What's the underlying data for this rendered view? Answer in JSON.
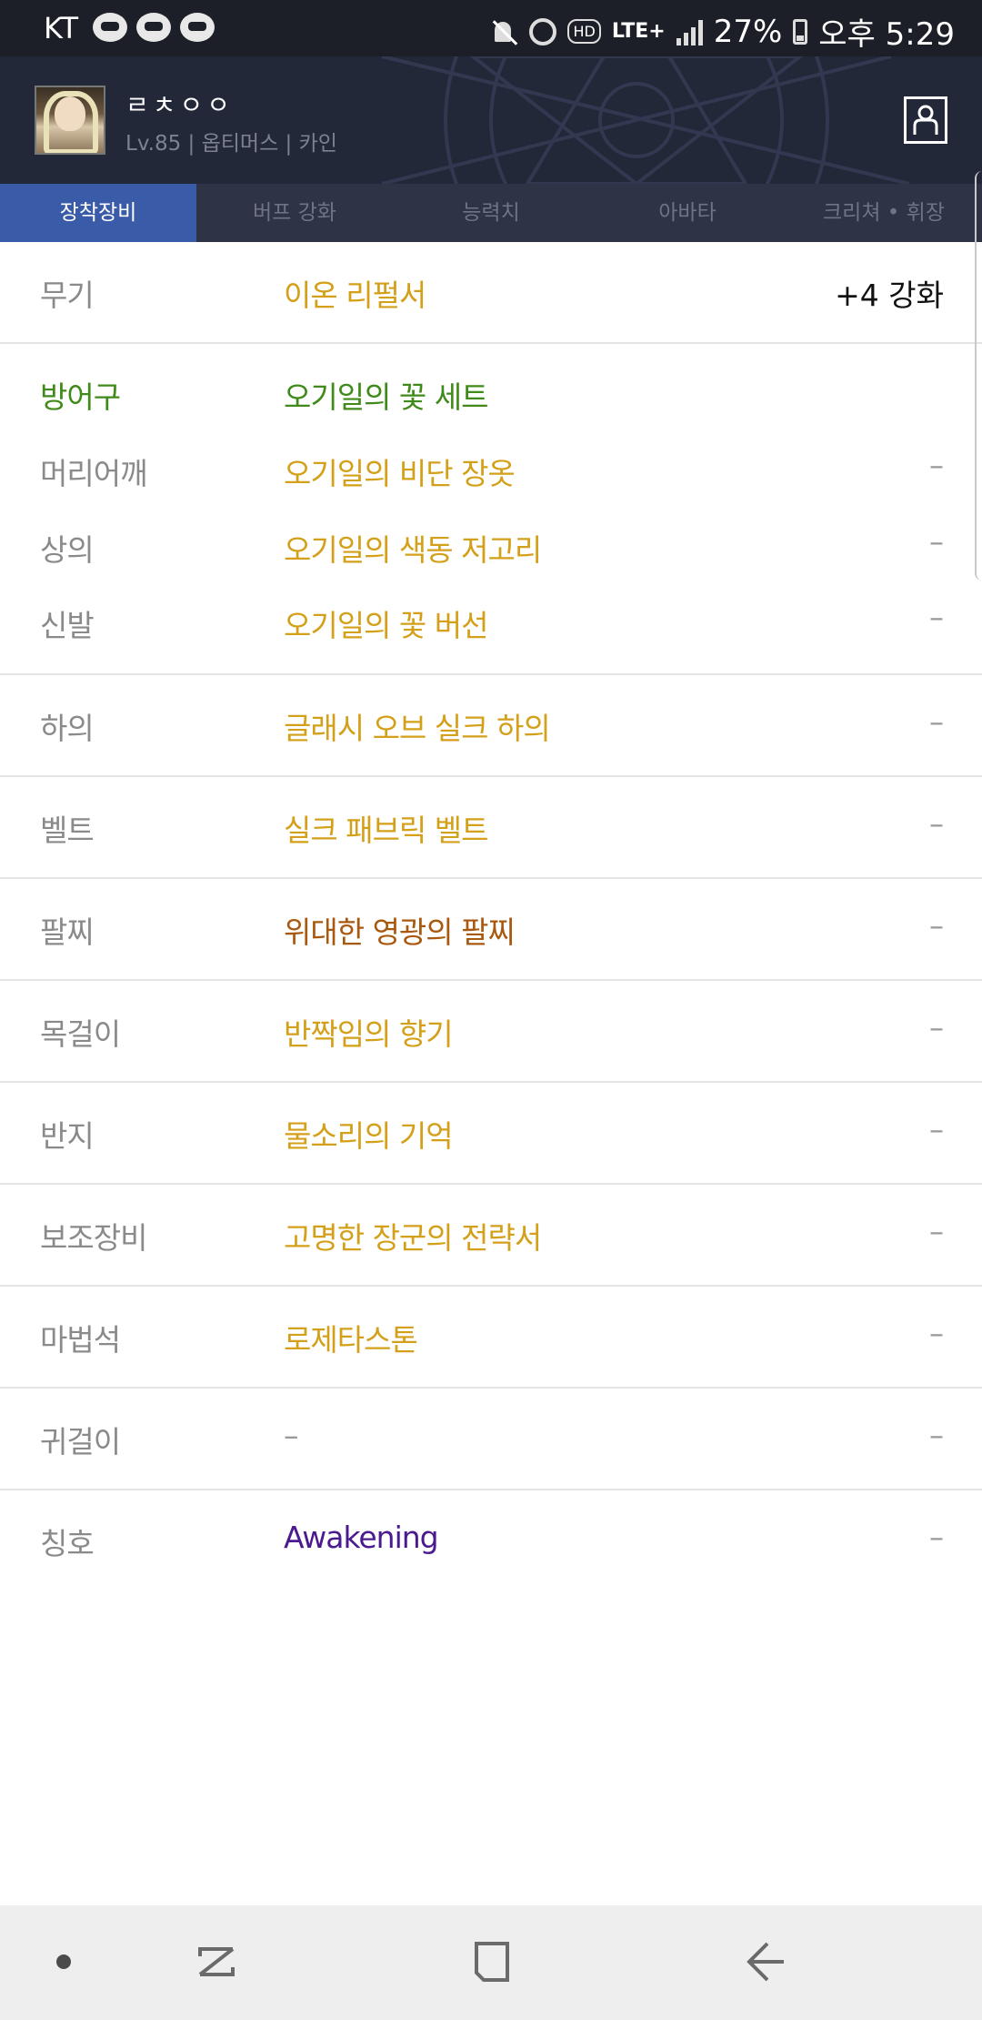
{
  "status_bar": {
    "carrier": "KT",
    "notification_icons": [
      "game-controller-icon",
      "app-notification-icon",
      "app-notification-icon"
    ],
    "hd_label": "HD",
    "network": "LTE+",
    "battery_percent": "27%",
    "time": "오후 5:29"
  },
  "header": {
    "character_name": "ㄹㅊㅇㅇ",
    "character_info": "Lv.85 | 옵티머스 | 카인"
  },
  "tabs": [
    {
      "label": "장착장비",
      "active": true
    },
    {
      "label": "버프 강화",
      "active": false
    },
    {
      "label": "능력치",
      "active": false
    },
    {
      "label": "아바타",
      "active": false
    },
    {
      "label": "크리쳐 • 휘장",
      "active": false
    }
  ],
  "equipment": {
    "weapon": {
      "slot": "무기",
      "name": "이온 리펄서",
      "detail": "+4 강화",
      "color": "#d4a019"
    },
    "armor": {
      "slot": "방어구",
      "set_name": "오기일의 꽃 세트",
      "slot_color": "#3f8a1a",
      "set_color": "#3f8a1a",
      "items": [
        {
          "slot": "머리어깨",
          "name": "오기일의 비단 장옷",
          "detail": "–",
          "color": "#d4a019"
        },
        {
          "slot": "상의",
          "name": "오기일의 색동 저고리",
          "detail": "–",
          "color": "#d4a019"
        },
        {
          "slot": "신발",
          "name": "오기일의 꽃 버선",
          "detail": "–",
          "color": "#d4a019"
        }
      ]
    },
    "others": [
      {
        "slot": "하의",
        "name": "글래시 오브 실크 하의",
        "detail": "–",
        "color": "#d4a019"
      },
      {
        "slot": "벨트",
        "name": "실크 패브릭 벨트",
        "detail": "–",
        "color": "#d4a019"
      },
      {
        "slot": "팔찌",
        "name": "위대한 영광의 팔찌",
        "detail": "–",
        "color": "#a8590f"
      },
      {
        "slot": "목걸이",
        "name": "반짝임의 향기",
        "detail": "–",
        "color": "#d4a019"
      },
      {
        "slot": "반지",
        "name": "물소리의 기억",
        "detail": "–",
        "color": "#d4a019"
      },
      {
        "slot": "보조장비",
        "name": "고명한 장군의 전략서",
        "detail": "–",
        "color": "#d4a019"
      },
      {
        "slot": "마법석",
        "name": "로제타스톤",
        "detail": "–",
        "color": "#d4a019"
      },
      {
        "slot": "귀걸이",
        "name": "–",
        "detail": "–",
        "color": "#9a9a9a"
      },
      {
        "slot": "칭호",
        "name": "Awakening",
        "detail": "–",
        "color": "#4b1a8f"
      }
    ]
  },
  "nav_bar": {
    "icons": [
      "dot-icon",
      "recent-apps-icon",
      "home-icon",
      "back-icon"
    ]
  }
}
